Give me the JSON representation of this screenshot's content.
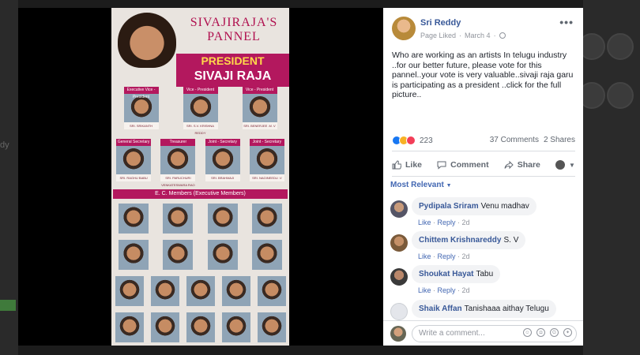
{
  "poster": {
    "title": "SIVAJIRAJA'S PANNEL",
    "president_label": "PRESIDENT",
    "president_name": "SIVAJI RAJA",
    "ec_band": "E. C. Members (Executive Members)",
    "row1": [
      {
        "role": "Executive Vice - President",
        "name": "SRI. SRIKANTH"
      },
      {
        "role": "Vice - President",
        "name": "SRI. S.V. KRISHNA REDDY"
      },
      {
        "role": "Vice - President",
        "name": "SRI. BENERJEE .M .V"
      }
    ],
    "row2": [
      {
        "role": "General Secretary",
        "name": "SRI. RAGHU BABU"
      },
      {
        "role": "Treasurer",
        "name": "SRI. PARUCHURI VENKATESWARA RAO"
      },
      {
        "role": "Joint - Secretary",
        "name": "SRI. BRAHMAJI"
      },
      {
        "role": "Joint - Secretary",
        "name": "SRI. NAGINEEDU .V"
      }
    ]
  },
  "post": {
    "author": "Sri Reddy",
    "page_liked": "Page Liked",
    "date": "March 4",
    "more": "•••",
    "text": "Who are working as an artists In telugu industry ..for our better future, please vote for this pannel..your vote is very valuable..sivaji raja garu is participating as a president ..click for the full picture..",
    "reaction_count": "223",
    "comments_count": "37 Comments",
    "shares_count": "2 Shares",
    "actions": {
      "like": "Like",
      "comment": "Comment",
      "share": "Share"
    },
    "most_relevant": "Most Relevant"
  },
  "comments": [
    {
      "name": "Pydipala Sriram",
      "text": "Venu madhav",
      "like": "Like",
      "reply": "Reply",
      "age": "2d"
    },
    {
      "name": "Chittem Krishnareddy",
      "text": "S. V",
      "like": "Like",
      "reply": "Reply",
      "age": "2d"
    },
    {
      "name": "Shoukat Hayat",
      "text": "Tabu",
      "like": "Like",
      "reply": "Reply",
      "age": "2d"
    },
    {
      "name": "Shaik Affan",
      "text": "Tanishaaa aithay Telugu",
      "like": "Like",
      "reply": "Reply",
      "age": "2d"
    }
  ],
  "write_comment": {
    "placeholder": "Write a comment..."
  }
}
